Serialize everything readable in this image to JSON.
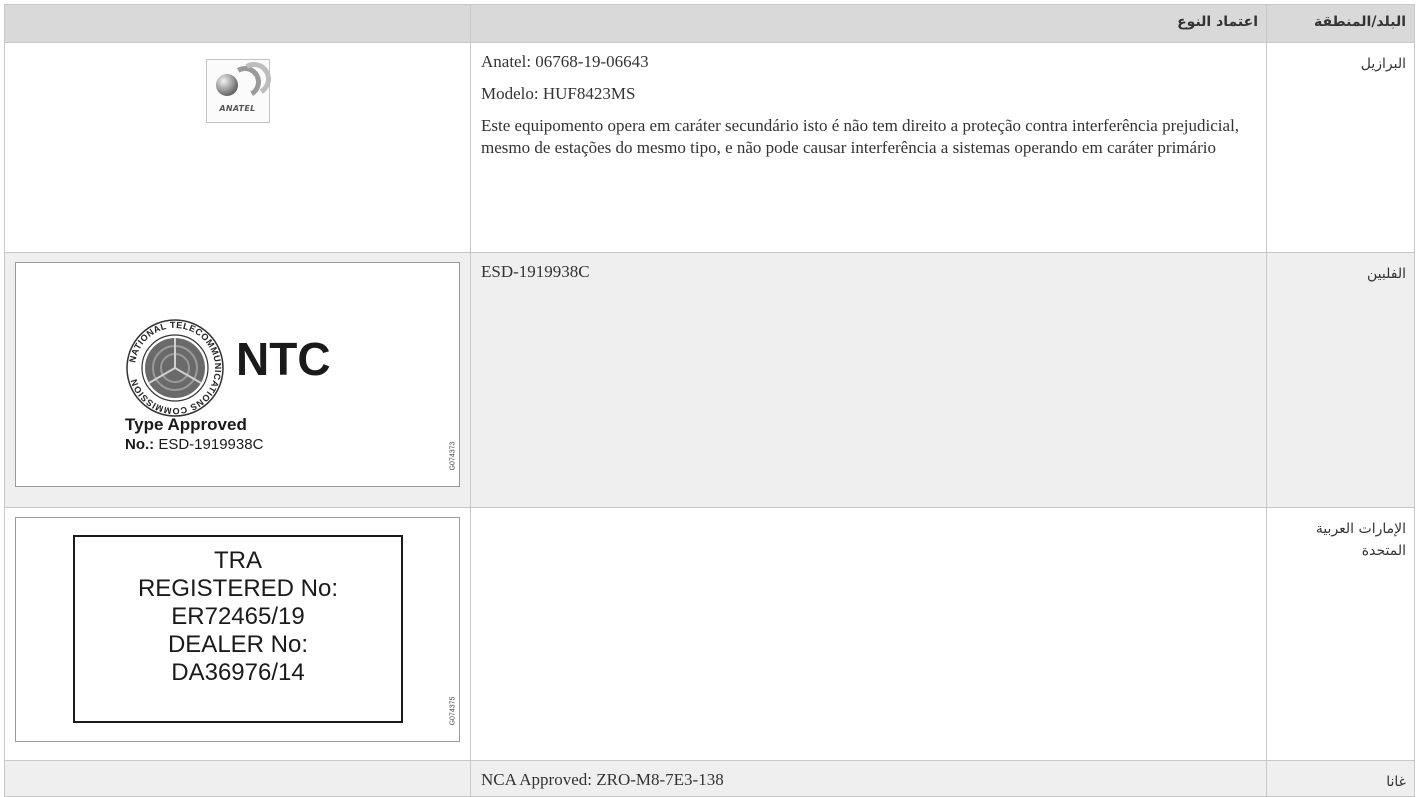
{
  "header": {
    "country_col": "البلد/المنطقة",
    "approval_col": "اعتماد النوع",
    "image_col": ""
  },
  "rows": [
    {
      "country": "البرازيل",
      "paragraphs": [
        "Anatel: 06768-19-06643",
        "Modelo: HUF8423MS",
        "Este equipomento opera em caráter secundário isto é não tem direito a proteção contra interferência prejudicial, mesmo de estações do mesmo tipo, e não pode causar interferência a sistemas operando em caráter primário"
      ],
      "logo": {
        "wordmark": "ANATEL",
        "icon": "anatel-logo-icon"
      }
    },
    {
      "country": "الفلبين",
      "paragraphs": [
        "ESD-1919938C"
      ],
      "label": {
        "seal_icon": "ntc-seal-icon",
        "seal_ring_text": "NATIONAL TELECOMMUNICATIONS COMMISSION",
        "brand": "NTC",
        "type_approved": "Type Approved",
        "no_label": "No.:",
        "no_value": " ESD-1919938C",
        "code": "G074373"
      }
    },
    {
      "country": "الإمارات العربية المتحدة",
      "paragraphs": [],
      "label": {
        "lines": [
          "TRA",
          "REGISTERED No:",
          "ER72465/19",
          "DEALER No:",
          "DA36976/14"
        ],
        "code": "G074375"
      }
    },
    {
      "country": "غانا",
      "paragraphs": [
        "NCA Approved: ZRO-M8-7E3-138"
      ]
    }
  ],
  "colors": {
    "header_bg": "#d9d9d9",
    "alt_row_bg": "#efefef",
    "border": "#c8c8c8",
    "text": "#333333"
  }
}
